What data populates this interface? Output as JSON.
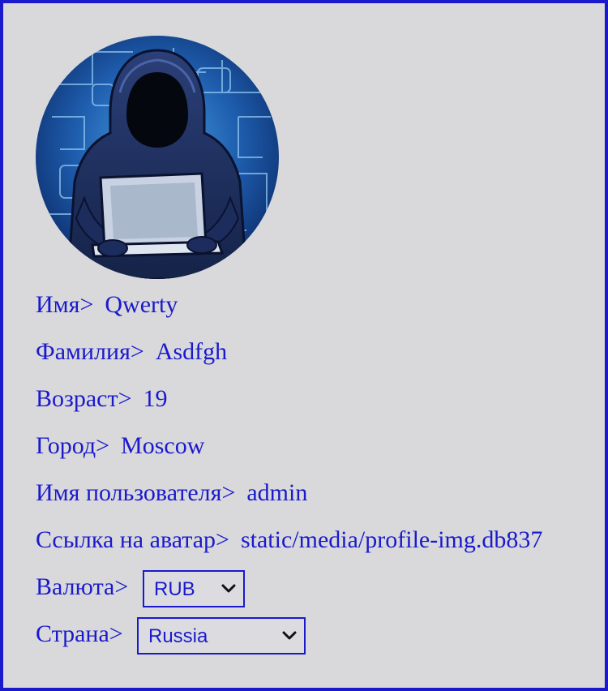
{
  "profile": {
    "avatar_icon": "hacker-avatar-image",
    "fields": [
      {
        "label": "Имя>",
        "value": "Qwerty"
      },
      {
        "label": "Фамилия>",
        "value": "Asdfgh"
      },
      {
        "label": "Возраст>",
        "value": "19"
      },
      {
        "label": "Город>",
        "value": "Moscow"
      },
      {
        "label": "Имя пользователя>",
        "value": "admin"
      },
      {
        "label": "Ссылка на аватар>",
        "value": "static/media/profile-img.db837"
      }
    ],
    "currency": {
      "label": "Валюта>",
      "selected": "RUB"
    },
    "country": {
      "label": "Страна>",
      "selected": "Russia"
    }
  },
  "colors": {
    "accent": "#1a1acc",
    "background": "#d9d9dc"
  }
}
